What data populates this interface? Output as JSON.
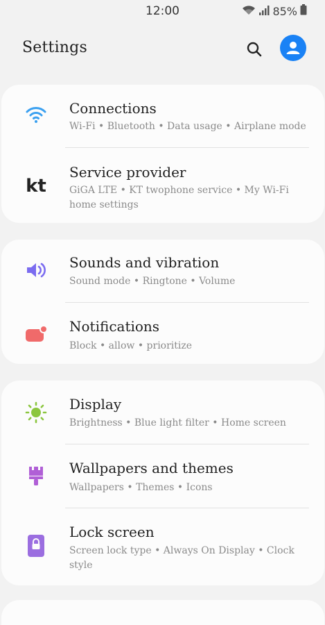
{
  "status_bar": {
    "time": "12:00",
    "battery": "85%",
    "icons": [
      "wifi-icon",
      "signal-icon",
      "battery-icon"
    ]
  },
  "app_bar": {
    "title": "Settings",
    "search_icon": "search-icon",
    "account_icon": "account-icon"
  },
  "groups": [
    {
      "items": [
        {
          "title": "Connections",
          "subtitle": "Wi-Fi • Bluetooth • Data usage • Airplane mode",
          "icon": "wifi-icon",
          "icon_color": "#3aa0f0"
        },
        {
          "title": "Service provider",
          "subtitle": "GiGA LTE • KT twophone service • My Wi-Fi home settings",
          "icon": "kt-logo-icon",
          "icon_text": "kt",
          "icon_color": "#222222"
        }
      ]
    },
    {
      "items": [
        {
          "title": "Sounds and vibration",
          "subtitle": "Sound mode • Ringtone • Volume",
          "icon": "speaker-icon",
          "icon_color": "#7b6cf0"
        },
        {
          "title": "Notifications",
          "subtitle": "Block • allow • prioritize",
          "icon": "notification-icon",
          "icon_color": "#f06a6a"
        }
      ]
    },
    {
      "items": [
        {
          "title": "Display",
          "subtitle": "Brightness • Blue light filter • Home screen",
          "icon": "sun-icon",
          "icon_color": "#8cc63f"
        },
        {
          "title": "Wallpapers and themes",
          "subtitle": "Wallpapers • Themes • Icons",
          "icon": "paintbrush-icon",
          "icon_color": "#b05fd6"
        },
        {
          "title": "Lock screen",
          "subtitle": "Screen lock type • Always On Display • Clock style",
          "icon": "lock-icon",
          "icon_color": "#9b6ee0"
        }
      ]
    }
  ]
}
